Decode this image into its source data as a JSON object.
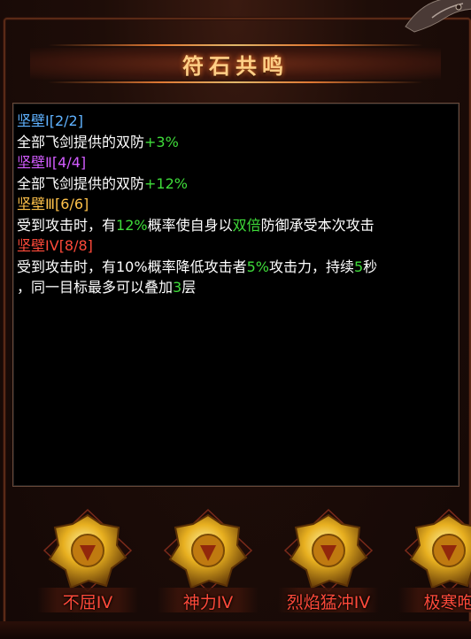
{
  "panel": {
    "title": "符石共鸣"
  },
  "effects": [
    {
      "header": {
        "name": "坚壁",
        "tier": "Ⅰ",
        "progress": "[2/2]"
      },
      "desc": [
        {
          "text": "全部飞剑提供的双防",
          "style": "white"
        },
        {
          "text": "+3%",
          "style": "green"
        }
      ]
    },
    {
      "header": {
        "name": "坚壁",
        "tier": "Ⅱ",
        "progress": "[4/4]"
      },
      "desc": [
        {
          "text": "全部飞剑提供的双防",
          "style": "white"
        },
        {
          "text": "+12%",
          "style": "green"
        }
      ]
    },
    {
      "header": {
        "name": "坚壁",
        "tier": "Ⅲ",
        "progress": "[6/6]"
      },
      "desc": [
        {
          "text": "受到攻击时，有",
          "style": "white"
        },
        {
          "text": "12%",
          "style": "green"
        },
        {
          "text": "概率使自身以",
          "style": "white"
        },
        {
          "text": "双倍",
          "style": "green"
        },
        {
          "text": "防御承受本次攻击",
          "style": "white"
        }
      ]
    },
    {
      "header": {
        "name": "坚壁",
        "tier": "IV",
        "progress": "[8/8]"
      },
      "desc": [
        {
          "text": "受到攻击时，有10%概率降低攻击者",
          "style": "white"
        },
        {
          "text": "5%",
          "style": "green"
        },
        {
          "text": "攻击力，持续",
          "style": "white"
        },
        {
          "text": "5",
          "style": "green"
        },
        {
          "text": "秒",
          "style": "white"
        }
      ],
      "desc2": [
        {
          "text": "，同一目标最多可以叠加",
          "style": "white"
        },
        {
          "text": "3",
          "style": "green"
        },
        {
          "text": "层",
          "style": "white"
        }
      ]
    }
  ],
  "header_colors": [
    "blue",
    "purple",
    "gold",
    "red"
  ],
  "runes": [
    {
      "label": "不屈IV",
      "icon": "rune-unyielding-icon"
    },
    {
      "label": "神力IV",
      "icon": "rune-divine-power-icon"
    },
    {
      "label": "烈焰猛冲IV",
      "icon": "rune-blazing-charge-icon"
    },
    {
      "label": "极寒咆",
      "icon": "rune-frost-roar-icon"
    }
  ],
  "colors": {
    "title": "#ffcf86",
    "green": "#3fdc3a",
    "blue": "#5fb2ff",
    "purple": "#d25cff",
    "gold": "#ffc24a",
    "red": "#ff4a3a",
    "rune_gold": "#e8b020"
  }
}
